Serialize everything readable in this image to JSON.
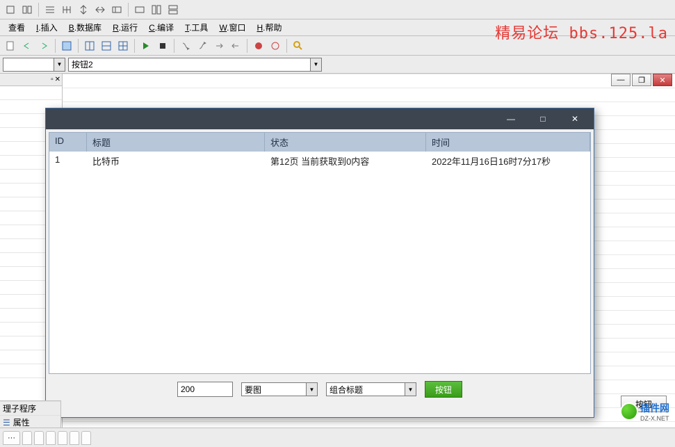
{
  "toolbar_top_icons": [
    "口",
    "旧",
    "芒",
    "哇",
    "丨",
    "王",
    "",
    "凹",
    "凹",
    "凹"
  ],
  "menu": {
    "view": "查看",
    "insert_u": "I",
    "insert": ".插入",
    "db_u": "B",
    "db": ".数据库",
    "run_u": "R",
    "run": ".运行",
    "compile_u": "C",
    "compile": ".编译",
    "tool_u": "T",
    "tool": ".工具",
    "window_u": "W",
    "window": ".窗口",
    "help_u": "H",
    "help": ".帮助"
  },
  "watermark": "精易论坛 bbs.125.la",
  "combo1": {
    "value": ""
  },
  "combo2": {
    "value": "按钮2"
  },
  "child": {
    "headers": {
      "id": "ID",
      "title": "标题",
      "status": "状态",
      "time": "时间"
    },
    "rows": [
      {
        "id": "1",
        "title": "比特币",
        "status": "第12页   当前获取到0内容",
        "time": "2022年11月16日16时7分17秒"
      }
    ],
    "input1": "200",
    "btn1": "要图",
    "select1": "组合标题",
    "btn2": "按钮"
  },
  "outer_button": "按钮",
  "left_bottom": {
    "row1": "理子程序",
    "row2": "属性"
  },
  "watermark2": {
    "brand": "插件网",
    "sub": "DZ-X.NET"
  }
}
